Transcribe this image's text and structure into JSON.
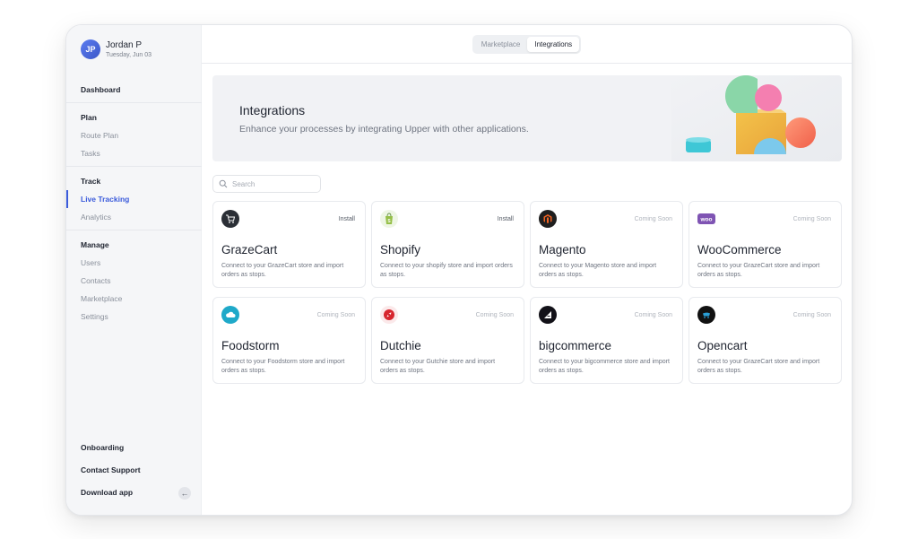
{
  "profile": {
    "initials": "JP",
    "name": "Jordan P",
    "date": "Tuesday, Jun 03"
  },
  "sidebar": {
    "dashboard": "Dashboard",
    "plan": {
      "heading": "Plan",
      "items": [
        "Route Plan",
        "Tasks"
      ]
    },
    "track": {
      "heading": "Track",
      "items": [
        "Live Tracking",
        "Analytics"
      ]
    },
    "manage": {
      "heading": "Manage",
      "items": [
        "Users",
        "Contacts",
        "Marketplace",
        "Settings"
      ]
    },
    "bottom": [
      "Onboarding",
      "Contact Support",
      "Download app"
    ],
    "back_icon": "←"
  },
  "tabs": [
    "Marketplace",
    "Integrations"
  ],
  "banner": {
    "title": "Integrations",
    "subtitle": "Enhance your processes by integrating Upper with other applications."
  },
  "search": {
    "placeholder": "Search"
  },
  "integrations": [
    {
      "name": "GrazeCart",
      "status": "Install",
      "desc": "Connect to your GrazeCart store and import orders as stops.",
      "logo_color": "#2b2f36",
      "icon": "cart-icon"
    },
    {
      "name": "Shopify",
      "status": "Install",
      "desc": "Connect to your shopify store and import orders as stops.",
      "logo_color": "#95bf47",
      "icon": "shopify-bag-icon"
    },
    {
      "name": "Magento",
      "status": "Coming Soon",
      "desc": "Connect to your Magento store and import orders as stops.",
      "logo_color": "#1f1f1f",
      "icon": "magento-icon"
    },
    {
      "name": "WooCommerce",
      "status": "Coming Soon",
      "desc": "Connect to your GrazeCart store and import orders as stops.",
      "logo_color": "#7f54b3",
      "icon": "woo-icon"
    },
    {
      "name": "Foodstorm",
      "status": "Coming Soon",
      "desc": "Connect to your Foodstorm store and import orders as stops.",
      "logo_color": "#1fa9c9",
      "icon": "cloud-icon"
    },
    {
      "name": "Dutchie",
      "status": "Coming Soon",
      "desc": "Connect to your Gutchie store and import orders as stops.",
      "logo_color": "#d7262e",
      "icon": "dutchie-icon"
    },
    {
      "name": "bigcommerce",
      "status": "Coming Soon",
      "desc": "Connect to your bigcommerce store and import orders as stops.",
      "logo_color": "#121118",
      "icon": "bigcommerce-icon"
    },
    {
      "name": "Opencart",
      "status": "Coming Soon",
      "desc": "Connect to your GrazeCart store and import orders as stops.",
      "logo_color": "#111111",
      "icon": "opencart-icon"
    }
  ]
}
